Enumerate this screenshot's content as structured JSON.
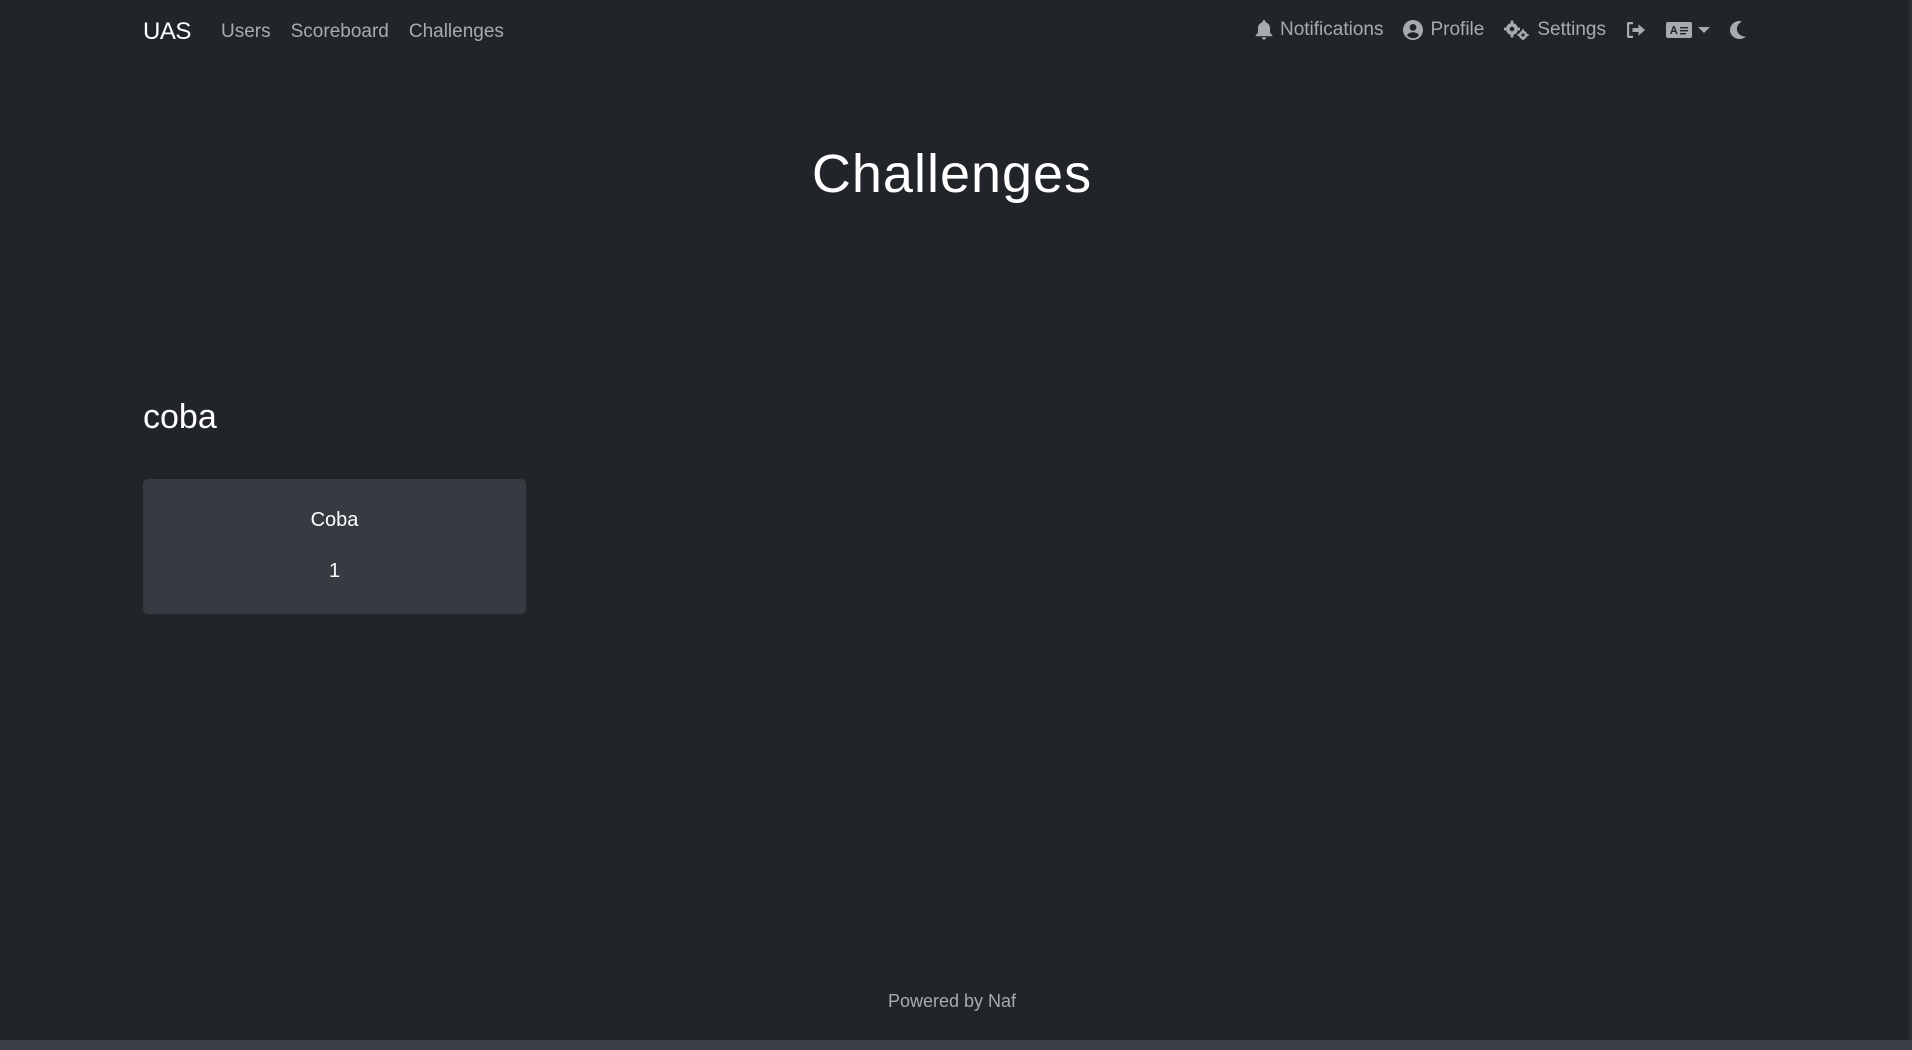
{
  "navbar": {
    "brand": "UAS",
    "left_links": [
      {
        "label": "Users"
      },
      {
        "label": "Scoreboard"
      },
      {
        "label": "Challenges"
      }
    ],
    "right_links": {
      "notifications": {
        "label": "Notifications",
        "icon": "bell-icon"
      },
      "profile": {
        "label": "Profile",
        "icon": "user-circle-icon"
      },
      "settings": {
        "label": "Settings",
        "icon": "gears-icon"
      },
      "logout": {
        "icon": "sign-out-icon"
      },
      "language": {
        "icon": "language-icon"
      },
      "theme": {
        "icon": "moon-icon"
      }
    }
  },
  "page": {
    "title": "Challenges"
  },
  "categories": [
    {
      "name": "coba",
      "challenges": [
        {
          "name": "Coba",
          "value": "1"
        }
      ]
    }
  ],
  "footer": {
    "text": "Powered by Naf"
  },
  "colors": {
    "background": "#212529",
    "card": "#373b41",
    "nav_text": "#a7abb0",
    "heading": "#ffffff"
  }
}
